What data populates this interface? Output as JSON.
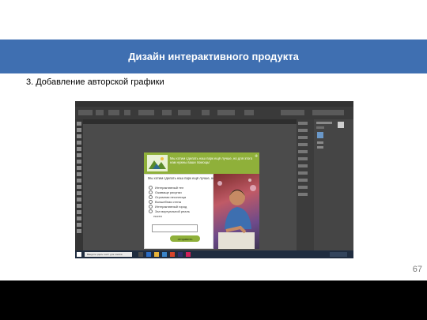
{
  "slide": {
    "title": "Дизайн интерактивного продукта",
    "subtitle": "3. Добавление авторской графики",
    "page_number": "67"
  },
  "artwork": {
    "header_text": "Мы хотим сделать наш парк ещё лучше, но для этого нам нужны ваши помощь!",
    "question": "Мы хотим сделать наш парк ещё лучше, но",
    "options": [
      "Интерактивный тел",
      "Оживаще рисунки",
      "Огромная песочница",
      "Волшебная стена",
      "Интерактивный город",
      "Зал виртуальной реаль"
    ],
    "option_continuation": "ности",
    "submit_label": "отправить",
    "brand_color": "#8fb03a"
  },
  "taskbar": {
    "search_placeholder": "Введите здесь текст для поиска"
  },
  "colors": {
    "title_bar": "#3f6fb1",
    "app_background": "#444444"
  }
}
